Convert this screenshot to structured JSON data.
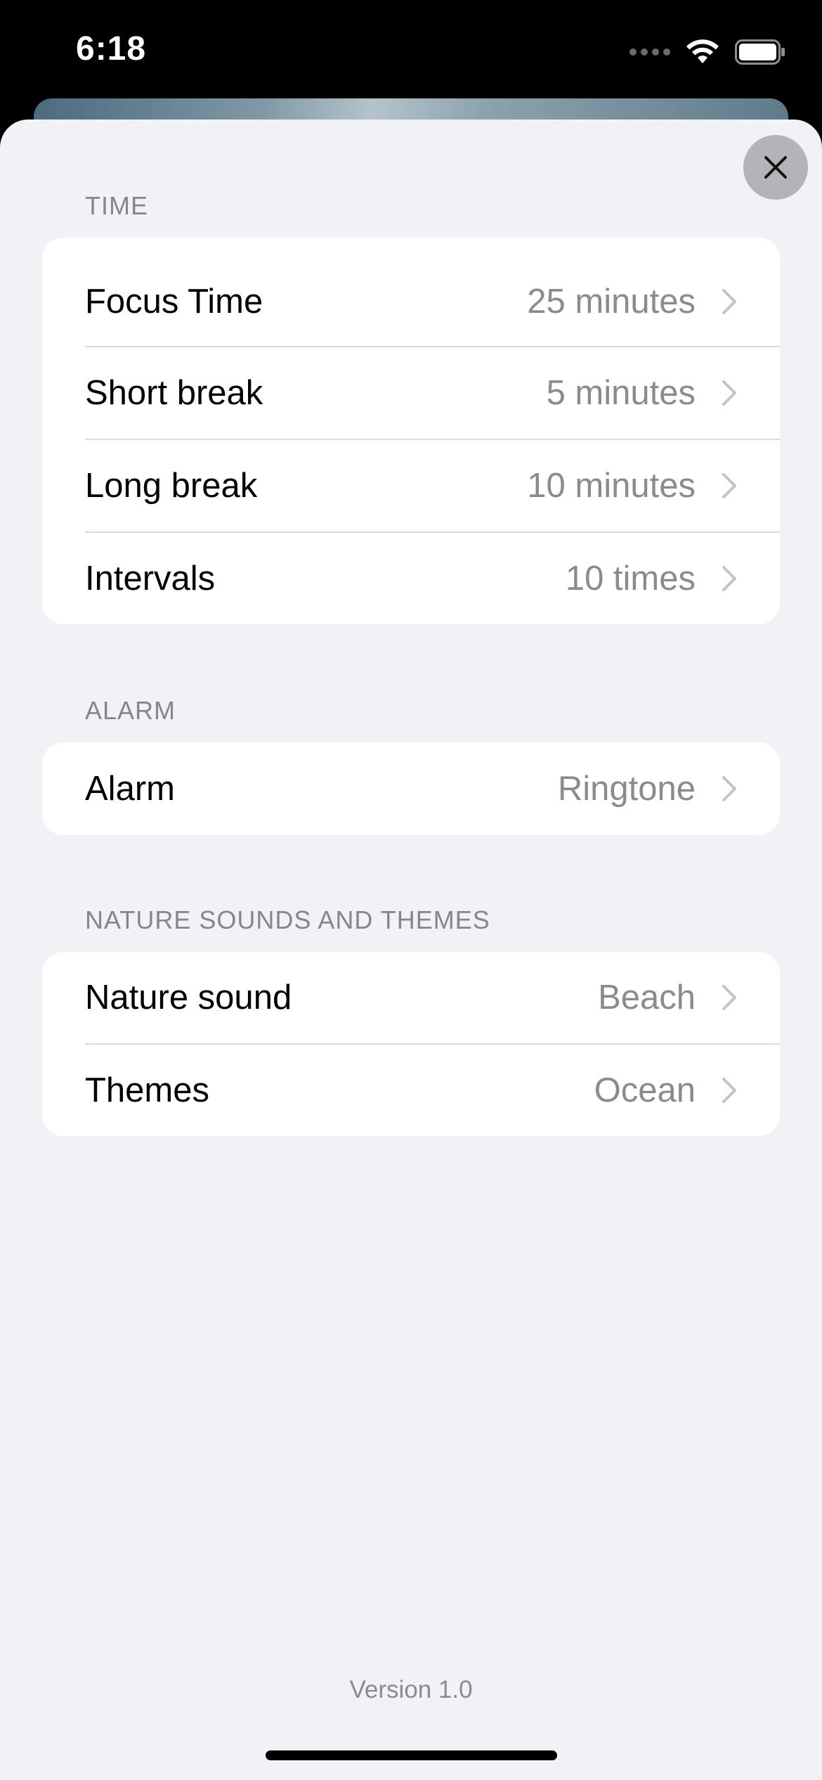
{
  "status_bar": {
    "time": "6:18"
  },
  "sections": {
    "time": {
      "header": "TIME",
      "rows": [
        {
          "label": "Focus Time",
          "value": "25 minutes"
        },
        {
          "label": "Short break",
          "value": "5 minutes"
        },
        {
          "label": "Long break",
          "value": "10 minutes"
        },
        {
          "label": "Intervals",
          "value": "10 times"
        }
      ]
    },
    "alarm": {
      "header": "ALARM",
      "rows": [
        {
          "label": "Alarm",
          "value": "Ringtone"
        }
      ]
    },
    "nature": {
      "header": "NATURE SOUNDS AND THEMES",
      "rows": [
        {
          "label": "Nature sound",
          "value": "Beach"
        },
        {
          "label": "Themes",
          "value": "Ocean"
        }
      ]
    }
  },
  "footer": {
    "version": "Version 1.0"
  },
  "colors": {
    "sheet_background": "#f1f1f6",
    "secondary_text": "#8a8a8f",
    "close_button": "#b3b3b8"
  },
  "icons": {
    "close": "close-icon",
    "chevron": "chevron-right-icon",
    "wifi": "wifi-icon",
    "battery": "battery-icon"
  }
}
